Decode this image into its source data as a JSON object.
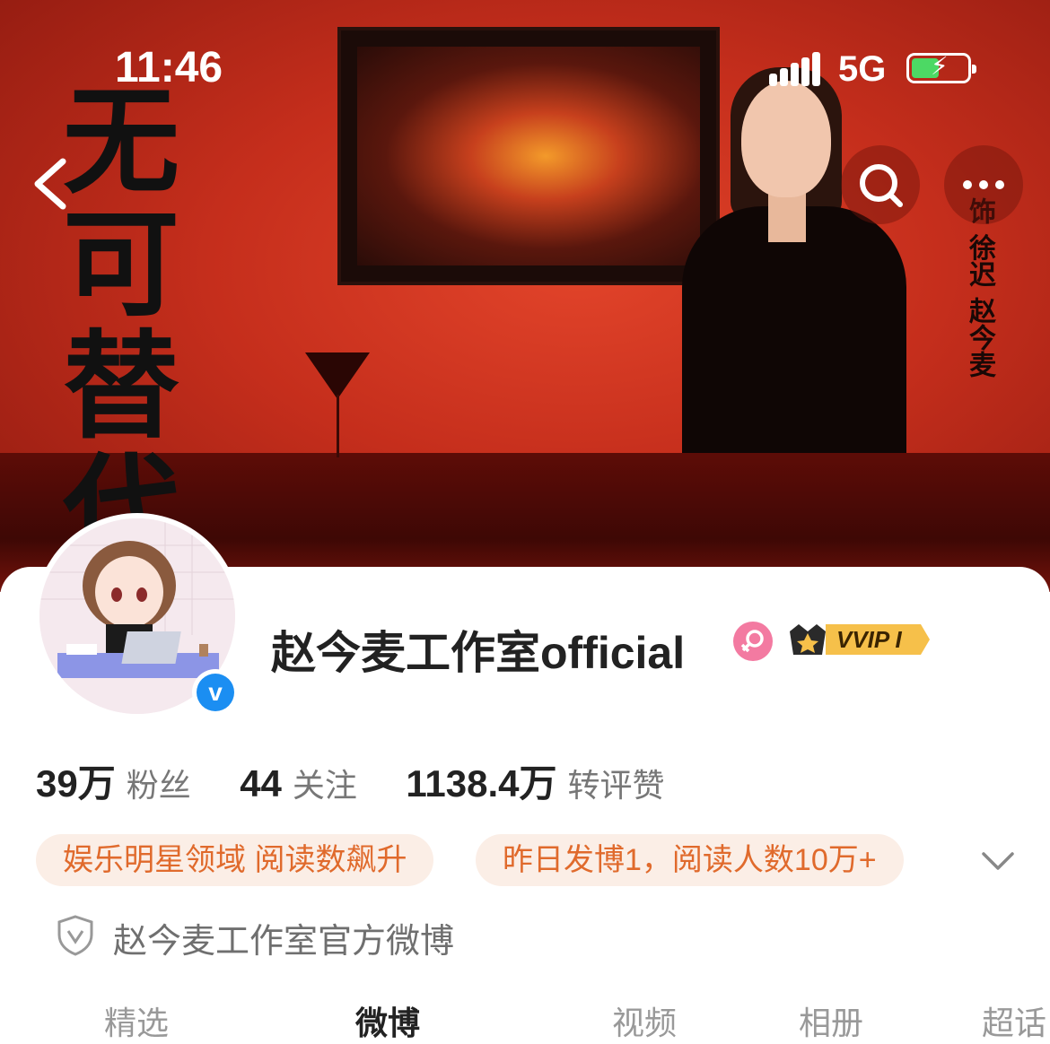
{
  "status_bar": {
    "time": "11:46",
    "network": "5G"
  },
  "cover": {
    "title": "无可替代",
    "side_text": "饰 徐迟 赵今麦",
    "accent_color": "#c52e1c"
  },
  "nav": {
    "back_icon": "chevron-left-icon",
    "search_icon": "search-icon",
    "more_icon": "ellipsis-icon"
  },
  "profile": {
    "name": "赵今麦工作室official",
    "vip_label": "VVIP I",
    "stats": [
      {
        "value": "39万",
        "label": "粉丝"
      },
      {
        "value": "44",
        "label": "关注"
      },
      {
        "value": "1138.4万",
        "label": "转评赞"
      }
    ],
    "tags": [
      "娱乐明星领域 阅读数飙升",
      "昨日发博1，阅读人数10万+"
    ],
    "description": "赵今麦工作室官方微博"
  },
  "tabs": [
    {
      "label": "精选"
    },
    {
      "label": "微博"
    },
    {
      "label": "视频"
    },
    {
      "label": "相册"
    },
    {
      "label": "超话"
    }
  ],
  "colors": {
    "tag_bg": "#fbeee6",
    "tag_text": "#e06a2c",
    "verify_blue": "#1b8ef2",
    "gender_pink": "#f37aa1"
  }
}
